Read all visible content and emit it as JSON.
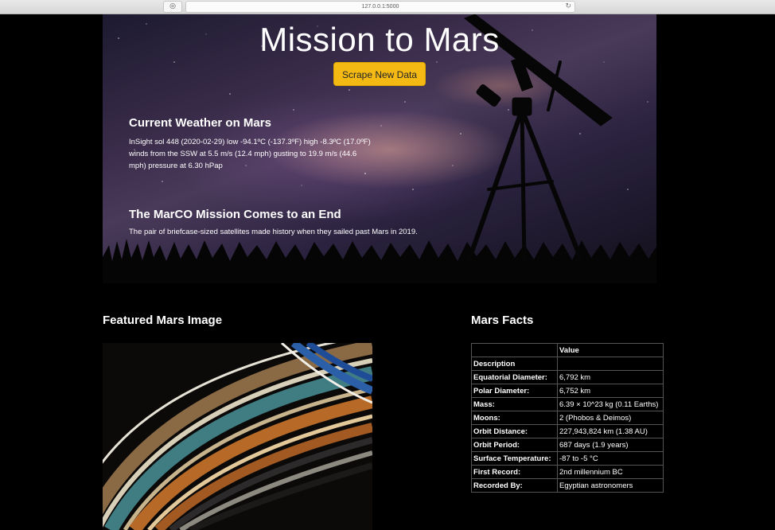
{
  "browser": {
    "url": "127.0.0.1:5000"
  },
  "hero": {
    "title": "Mission to Mars",
    "scrape_button": "Scrape New Data",
    "weather_heading": "Current Weather on Mars",
    "weather_text": "InSight sol 448 (2020-02-29) low -94.1ºC (-137.3ºF) high -8.3ºC (17.0ºF) winds from the SSW at 5.5 m/s (12.4 mph) gusting to 19.9 m/s (44.6 mph) pressure at 6.30 hPap",
    "news_heading": "The MarCO Mission Comes to an End",
    "news_text": "The pair of briefcase-sized satellites made history when they sailed past Mars in 2019."
  },
  "featured": {
    "heading": "Featured Mars Image"
  },
  "facts": {
    "heading": "Mars Facts",
    "header_label": "",
    "header_value": "Value",
    "rows": [
      {
        "label": "Description",
        "value": ""
      },
      {
        "label": "Equatorial Diameter:",
        "value": "6,792 km"
      },
      {
        "label": "Polar Diameter:",
        "value": "6,752 km"
      },
      {
        "label": "Mass:",
        "value": "6.39 × 10^23 kg (0.11 Earths)"
      },
      {
        "label": "Moons:",
        "value": "2 (Phobos & Deimos)"
      },
      {
        "label": "Orbit Distance:",
        "value": "227,943,824 km (1.38 AU)"
      },
      {
        "label": "Orbit Period:",
        "value": "687 days (1.9 years)"
      },
      {
        "label": "Surface Temperature:",
        "value": "-87 to -5 °C"
      },
      {
        "label": "First Record:",
        "value": "2nd millennium BC"
      },
      {
        "label": "Recorded By:",
        "value": "Egyptian astronomers"
      }
    ]
  },
  "colors": {
    "page_background": "#000000",
    "button": "#f5b914"
  }
}
